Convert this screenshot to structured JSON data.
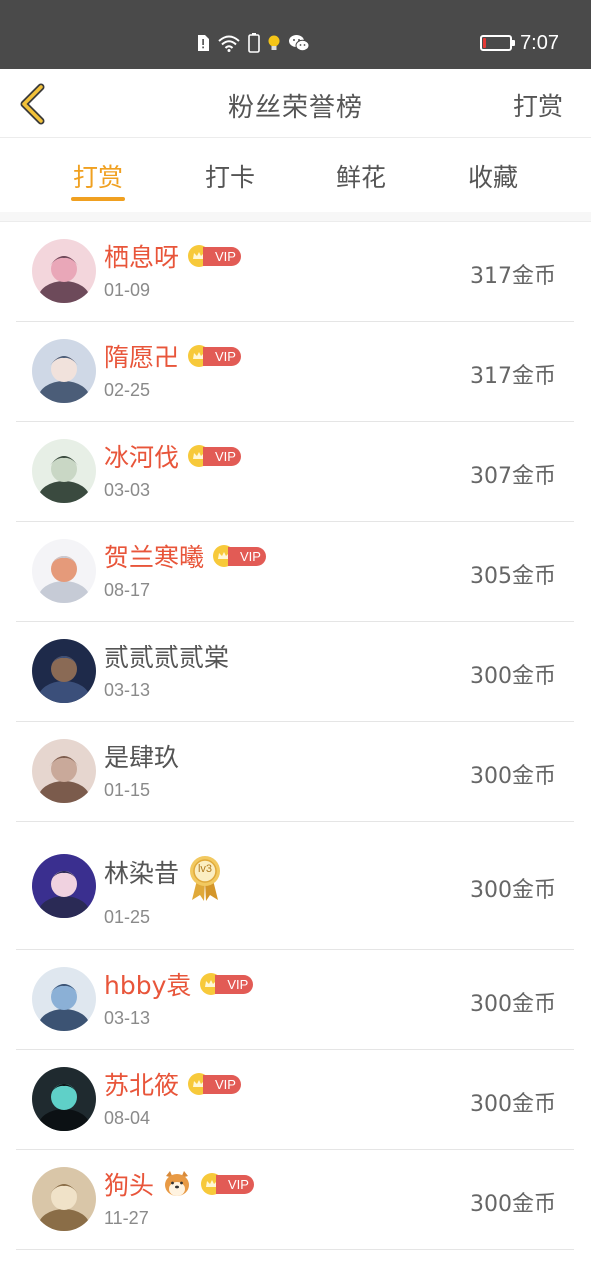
{
  "status_bar": {
    "time": "7:07",
    "battery_level": 0.12,
    "battery_color": "#e53935"
  },
  "header": {
    "title": "粉丝荣誉榜",
    "action": "打赏"
  },
  "tabs": [
    {
      "label": "打赏",
      "active": true
    },
    {
      "label": "打卡",
      "active": false
    },
    {
      "label": "鲜花",
      "active": false
    },
    {
      "label": "收藏",
      "active": false
    }
  ],
  "accent_color": "#f0a020",
  "vip_name_color": "#e8553a",
  "rows": [
    {
      "name": "栖息呀",
      "vip": true,
      "date": "01-09",
      "amount": "317金币"
    },
    {
      "name": "隋愿卍",
      "vip": true,
      "date": "02-25",
      "amount": "317金币"
    },
    {
      "name": "冰河伐",
      "vip": true,
      "date": "03-03",
      "amount": "307金币"
    },
    {
      "name": "贺兰寒曦",
      "vip": true,
      "date": "08-17",
      "amount": "305金币"
    },
    {
      "name": "贰贰贰贰棠",
      "vip": false,
      "date": "03-13",
      "amount": "300金币"
    },
    {
      "name": "是肆玖",
      "vip": false,
      "date": "01-15",
      "amount": "300金币"
    },
    {
      "name": "林染昔",
      "vip": false,
      "level_badge": "lv3",
      "date": "01-25",
      "amount": "300金币"
    },
    {
      "name": "hbby袁",
      "vip": true,
      "date": "03-13",
      "amount": "300金币"
    },
    {
      "name": "苏北筱",
      "vip": true,
      "date": "08-04",
      "amount": "300金币"
    },
    {
      "name": "狗头",
      "vip": true,
      "emoji": "dog-face-emoji",
      "date": "11-27",
      "amount": "300金币"
    }
  ],
  "vip_label": "VIP"
}
